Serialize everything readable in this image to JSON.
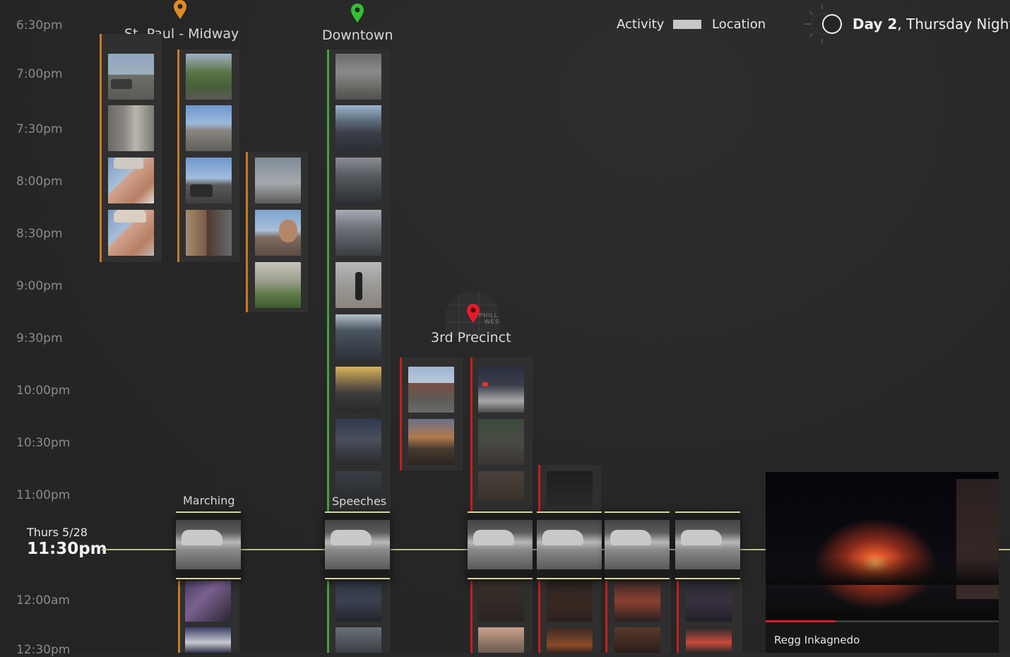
{
  "header": {
    "legend_activity": "Activity",
    "legend_location": "Location",
    "day_bold": "Day 2",
    "day_rest": ", Thursday Night"
  },
  "times": [
    "6:30pm",
    "7:00pm",
    "7:30pm",
    "8:00pm",
    "8:30pm",
    "9:00pm",
    "9:30pm",
    "10:00pm",
    "10:30pm",
    "11:00pm",
    "12:00am",
    "12:30pm"
  ],
  "current": {
    "date": "Thurs 5/28",
    "time": "11:30pm"
  },
  "locations": {
    "stpaul": "St. Paul - Midway",
    "downtown": "Downtown",
    "precinct": "3rd Precinct"
  },
  "activities": {
    "marching": "Marching",
    "speeches": "Speeches"
  },
  "map_text": {
    "line1": "PHILL",
    "line2": "WES"
  },
  "video": {
    "author": "Regg Inkagnedo",
    "progress": 0.3
  },
  "colors": {
    "stpaul": "#c87a24",
    "downtown": "#3fa53a",
    "precinct": "#c81e1e",
    "timeline": "#d7d49a"
  }
}
